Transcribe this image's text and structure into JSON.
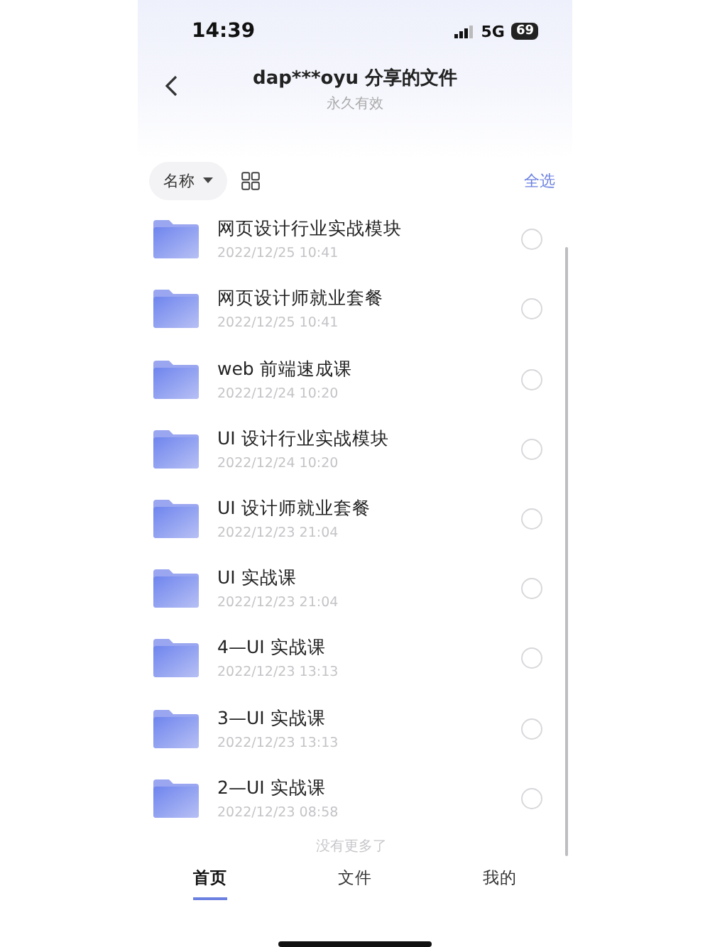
{
  "status_bar": {
    "time": "14:39",
    "network": "5G",
    "battery": "69"
  },
  "header": {
    "title": "dap***oyu 分享的文件",
    "subtitle": "永久有效"
  },
  "toolbar": {
    "sort_label": "名称",
    "select_all": "全选"
  },
  "files": [
    {
      "name": "网页设计行业实战模块",
      "date": "2022/12/25 10:41",
      "selected": false
    },
    {
      "name": "网页设计师就业套餐",
      "date": "2022/12/25 10:41",
      "selected": false
    },
    {
      "name": "web 前端速成课",
      "date": "2022/12/24 10:20",
      "selected": false
    },
    {
      "name": "UI 设计行业实战模块",
      "date": "2022/12/24 10:20",
      "selected": false
    },
    {
      "name": "UI 设计师就业套餐",
      "date": "2022/12/23 21:04",
      "selected": false
    },
    {
      "name": "UI 实战课",
      "date": "2022/12/23 21:04",
      "selected": false
    },
    {
      "name": "4—UI 实战课",
      "date": "2022/12/23 13:13",
      "selected": false
    },
    {
      "name": "3—UI 实战课",
      "date": "2022/12/23 13:13",
      "selected": false
    },
    {
      "name": "2—UI 实战课",
      "date": "2022/12/23 08:58",
      "selected": false
    }
  ],
  "end_note": "没有更多了",
  "tabs": [
    {
      "label": "首页",
      "selected": true
    },
    {
      "label": "文件",
      "selected": false
    },
    {
      "label": "我的",
      "selected": false
    }
  ]
}
